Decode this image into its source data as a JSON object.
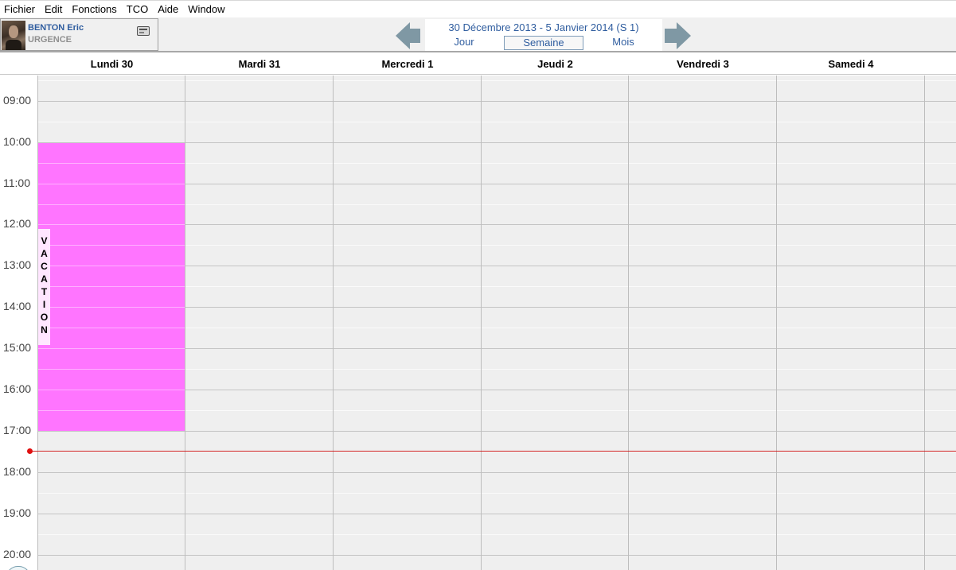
{
  "menu": [
    "Fichier",
    "Edit",
    "Fonctions",
    "TCO",
    "Aide",
    "Window"
  ],
  "user": {
    "name": "BENTON Eric",
    "department": "URGENCE"
  },
  "period": {
    "title": "30 Décembre 2013 - 5 Janvier 2014 (S 1)",
    "views": {
      "day": "Jour",
      "week": "Semaine",
      "month": "Mois"
    },
    "selected_view": "Semaine"
  },
  "days": [
    "Lundi 30",
    "Mardi 31",
    "Mercredi 1",
    "Jeudi 2",
    "Vendredi 3",
    "Samedi 4"
  ],
  "times": [
    "09:00",
    "10:00",
    "11:00",
    "12:00",
    "13:00",
    "14:00",
    "15:00",
    "16:00",
    "17:00",
    "18:00",
    "19:00",
    "20:00"
  ],
  "event": {
    "label": "VACATION",
    "day": "Lundi 30",
    "start": "10:00",
    "end": "17:00",
    "color": "#ff75ff"
  },
  "current_time_marker": "17:30",
  "colors": {
    "accent": "#2f5d9f",
    "nav_arrow": "#7f98a4",
    "now_line": "#cc2020",
    "event_fill": "#ff75ff"
  }
}
